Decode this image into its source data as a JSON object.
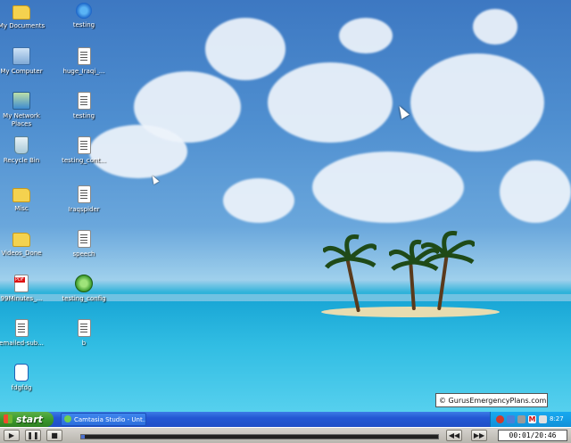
{
  "desktop": {
    "icons": [
      {
        "label": "My Documents",
        "type": "folder"
      },
      {
        "label": "testing",
        "type": "ie"
      },
      {
        "label": "My Computer",
        "type": "comp"
      },
      {
        "label": "huge_Iraqi_...",
        "type": "doc"
      },
      {
        "label": "My Network Places",
        "type": "net"
      },
      {
        "label": "testing",
        "type": "doc"
      },
      {
        "label": "Recycle Bin",
        "type": "bin"
      },
      {
        "label": "testing_cont...",
        "type": "doc"
      },
      {
        "label": "Misc",
        "type": "folder"
      },
      {
        "label": "Iraqspider",
        "type": "doc"
      },
      {
        "label": "Videos_Done",
        "type": "folder"
      },
      {
        "label": "speech",
        "type": "doc"
      },
      {
        "label": "99Minutes_...",
        "type": "pdf"
      },
      {
        "label": "testing_config",
        "type": "camt"
      },
      {
        "label": "emailed-sub...",
        "type": "doc"
      },
      {
        "label": "b",
        "type": "doc"
      },
      {
        "label": "fdgfdg",
        "type": "shortcut"
      }
    ],
    "watermark": "© GurusEmergencyPlans.com"
  },
  "taskbar": {
    "start_label": "start",
    "task_label": "Camtasia Studio - Unt...",
    "clock": "8:27 PM"
  },
  "player": {
    "timecode": "00:01/20:46",
    "progress": 0.01
  },
  "colors": {
    "taskbar": "#2458d4",
    "start_green": "#3c9a2c",
    "tray": "#1291d9"
  }
}
